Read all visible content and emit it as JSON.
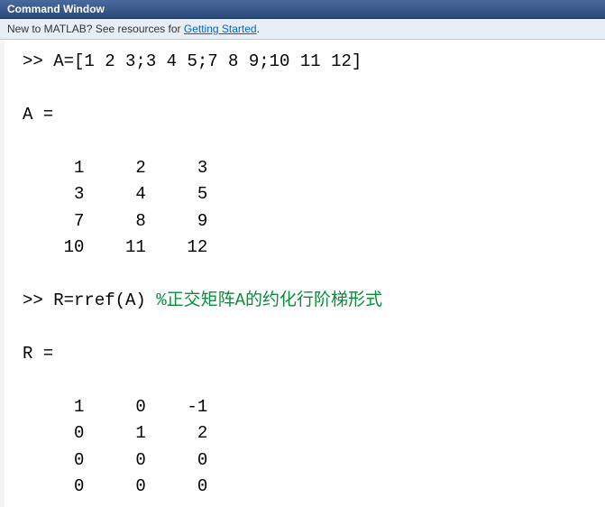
{
  "title_bar": {
    "title": "Command Window"
  },
  "hint_bar": {
    "prefix": "New to MATLAB? See resources for ",
    "link_text": "Getting Started",
    "suffix": "."
  },
  "console": {
    "prompt": ">>",
    "line1_command": "A=[1 2 3;3 4 5;7 8 9;10 11 12]",
    "line_A_header": "A =",
    "matrix_A": [
      "     1     2     3",
      "     3     4     5",
      "     7     8     9",
      "    10    11    12"
    ],
    "line2_command": "R=rref(A)",
    "line2_comment": "%正交矩阵A的约化行阶梯形式",
    "line_R_header": "R =",
    "matrix_R": [
      "     1     0    -1",
      "     0     1     2",
      "     0     0     0",
      "     0     0     0"
    ]
  },
  "chart_data": {
    "type": "table",
    "title": "MATLAB rref output",
    "A": [
      [
        1,
        2,
        3
      ],
      [
        3,
        4,
        5
      ],
      [
        7,
        8,
        9
      ],
      [
        10,
        11,
        12
      ]
    ],
    "R": [
      [
        1,
        0,
        -1
      ],
      [
        0,
        1,
        2
      ],
      [
        0,
        0,
        0
      ],
      [
        0,
        0,
        0
      ]
    ]
  }
}
